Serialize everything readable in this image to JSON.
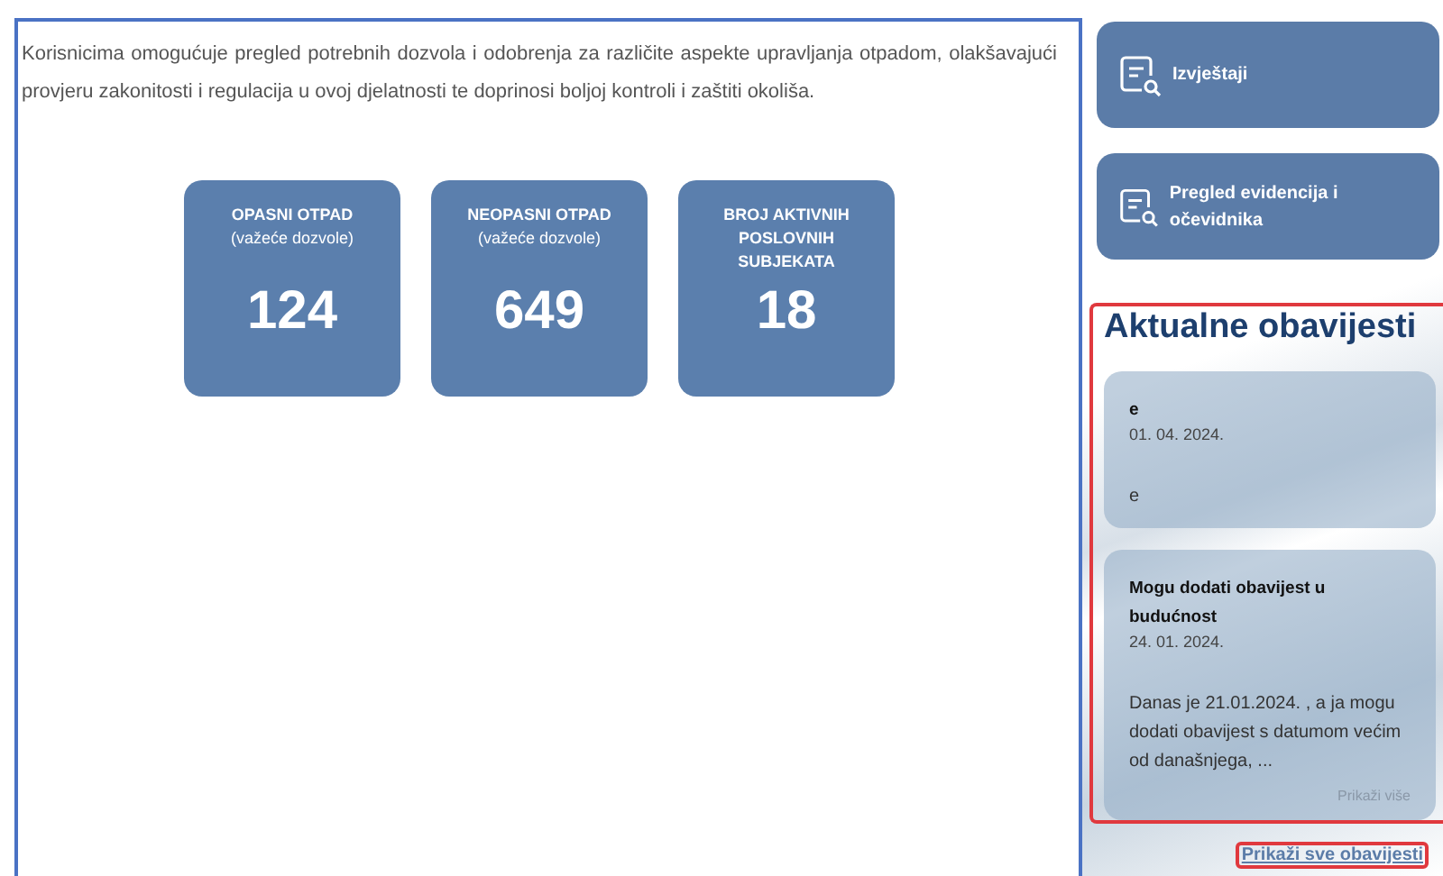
{
  "intro": "Korisnicima omogućuje pregled potrebnih dozvola i odobrenja za različite aspekte upravljanja otpadom, olakšavajući provjeru zakonitosti i regulacija u ovoj djelatnosti te doprinosi boljoj kontroli i zaštiti okoliša.",
  "stats": [
    {
      "label": "OPASNI OTPAD",
      "sublabel": "(važeće dozvole)",
      "value": "124"
    },
    {
      "label": "NEOPASNI OTPAD",
      "sublabel": "(važeće dozvole)",
      "value": "649"
    },
    {
      "label": "BROJ AKTIVNIH POSLOVNIH SUBJEKATA",
      "value": "18"
    }
  ],
  "actions": [
    {
      "label": "Izvještaji"
    },
    {
      "label": "Pregled evidencija i očevidnika"
    }
  ],
  "notices": {
    "title": "Aktualne obavijesti",
    "items": [
      {
        "title": "e",
        "date": "01. 04. 2024.",
        "text": "e"
      },
      {
        "title": "Mogu dodati obavijest u budućnost",
        "date": "24. 01. 2024.",
        "text": "Danas je 21.01.2024. , a ja mogu dodati obavijest s datumom većim od današnjega, ...",
        "more": "Prikaži više"
      }
    ],
    "all_link": "Prikaži sve obavijesti"
  }
}
